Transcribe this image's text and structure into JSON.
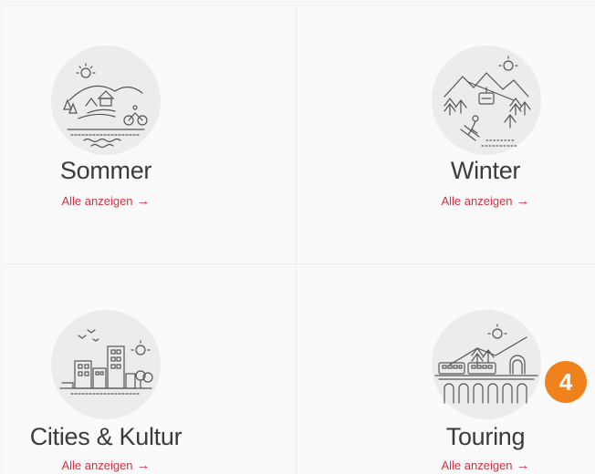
{
  "categories": [
    {
      "id": "sommer",
      "title": "Sommer",
      "link": "Alle anzeigen",
      "arrow": "→"
    },
    {
      "id": "winter",
      "title": "Winter",
      "link": "Alle anzeigen",
      "arrow": "→"
    },
    {
      "id": "cities",
      "title": "Cities & Kultur",
      "link": "Alle anzeigen",
      "arrow": "→"
    },
    {
      "id": "touring",
      "title": "Touring",
      "link": "Alle anzeigen",
      "arrow": "→"
    }
  ],
  "badge": {
    "label": "4"
  },
  "colors": {
    "accent": "#d6303e",
    "badge": "#f0821e",
    "text": "#3b3b3b"
  }
}
